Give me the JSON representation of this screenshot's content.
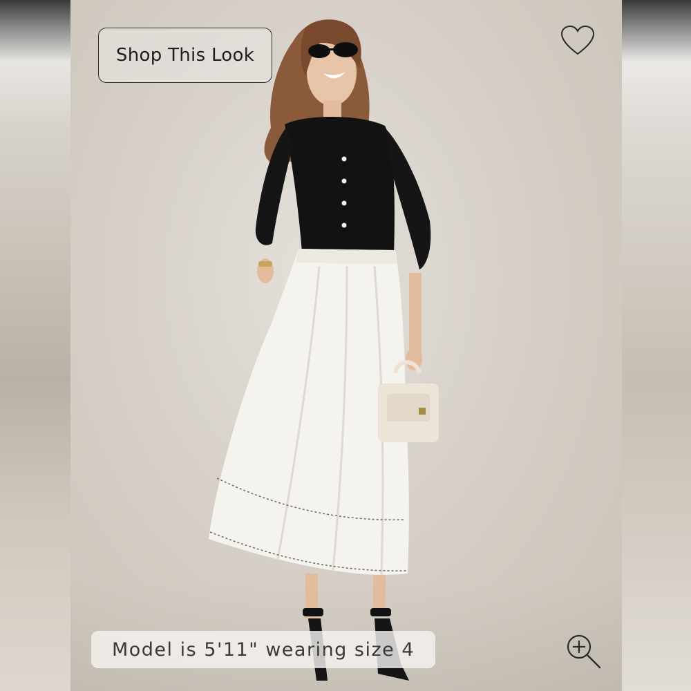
{
  "overlay": {
    "shop_button_label": "Shop This Look",
    "model_caption": "Model is 5'11\" wearing size 4"
  },
  "icons": {
    "favorite": "heart-outline-icon",
    "zoom": "zoom-in-icon"
  },
  "colors": {
    "backdrop": "#d6d0c8",
    "cardigan": "#111111",
    "skirt": "#f4f2ec",
    "bag": "#ece3d6",
    "button_border": "#2b2b2b"
  }
}
